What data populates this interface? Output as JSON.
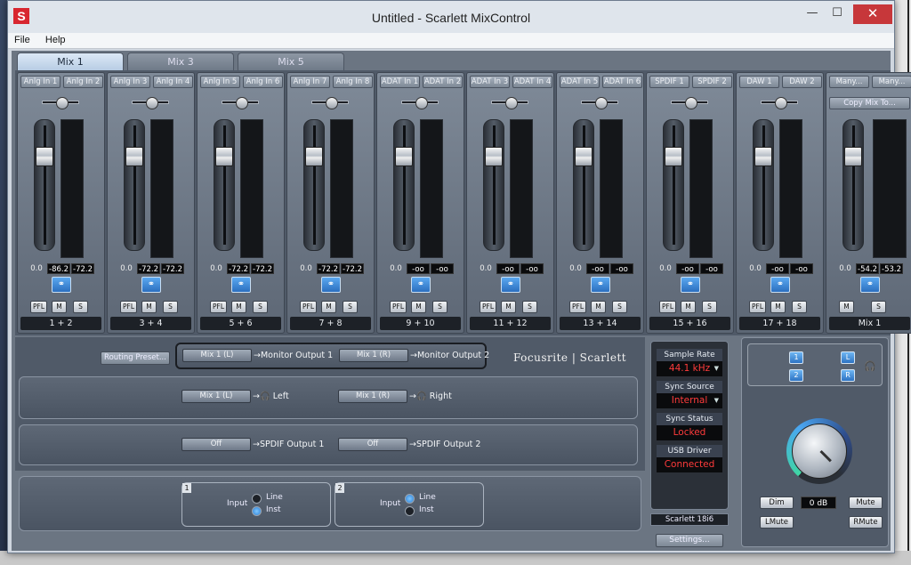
{
  "window": {
    "title": "Untitled - Scarlett MixControl",
    "app_icon_letter": "S",
    "min_glyph": "—",
    "max_glyph": "☐",
    "close_glyph": "✕"
  },
  "menu": [
    "File",
    "Help"
  ],
  "tabs": [
    {
      "label": "Mix 1",
      "active": true
    },
    {
      "label": "Mix 3",
      "active": false
    },
    {
      "label": "Mix 5",
      "active": false
    }
  ],
  "strips": [
    {
      "in_l": "Anlg In 1",
      "in_r": "Anlg In 2",
      "v0": "0.0",
      "v1": "-86.2",
      "v2": "-72.2",
      "pfl": "PFL",
      "m": "M",
      "s": "S",
      "name": "1 + 2",
      "level": 0.8
    },
    {
      "in_l": "Anlg In 3",
      "in_r": "Anlg In 4",
      "v0": "0.0",
      "v1": "-72.2",
      "v2": "-72.2",
      "pfl": "PFL",
      "m": "M",
      "s": "S",
      "name": "3 + 4",
      "level": 0.8
    },
    {
      "in_l": "Anlg In 5",
      "in_r": "Anlg In 6",
      "v0": "0.0",
      "v1": "-72.2",
      "v2": "-72.2",
      "pfl": "PFL",
      "m": "M",
      "s": "S",
      "name": "5 + 6",
      "level": 0.8
    },
    {
      "in_l": "Anlg In 7",
      "in_r": "Anlg In 8",
      "v0": "0.0",
      "v1": "-72.2",
      "v2": "-72.2",
      "pfl": "PFL",
      "m": "M",
      "s": "S",
      "name": "7 + 8",
      "level": 0.8
    },
    {
      "in_l": "ADAT In 1",
      "in_r": "ADAT In 2",
      "v0": "0.0",
      "v1": "-oo",
      "v2": "-oo",
      "pfl": "PFL",
      "m": "M",
      "s": "S",
      "name": "9 + 10",
      "level": 0.8
    },
    {
      "in_l": "ADAT In 3",
      "in_r": "ADAT In 4",
      "v0": "0.0",
      "v1": "-oo",
      "v2": "-oo",
      "pfl": "PFL",
      "m": "M",
      "s": "S",
      "name": "11 + 12",
      "level": 0.8
    },
    {
      "in_l": "ADAT In 5",
      "in_r": "ADAT In 6",
      "v0": "0.0",
      "v1": "-oo",
      "v2": "-oo",
      "pfl": "PFL",
      "m": "M",
      "s": "S",
      "name": "13 + 14",
      "level": 0.8
    },
    {
      "in_l": "SPDIF 1",
      "in_r": "SPDIF 2",
      "v0": "0.0",
      "v1": "-oo",
      "v2": "-oo",
      "pfl": "PFL",
      "m": "M",
      "s": "S",
      "name": "15 + 16",
      "level": 0.8
    },
    {
      "in_l": "DAW 1",
      "in_r": "DAW 2",
      "v0": "0.0",
      "v1": "-oo",
      "v2": "-oo",
      "pfl": "PFL",
      "m": "M",
      "s": "S",
      "name": "17 + 18",
      "level": 0.8
    }
  ],
  "mix_strip": {
    "in_l": "Many...",
    "in_r": "Many...",
    "copy": "Copy Mix To...",
    "v0": "0.0",
    "v1": "-54.2",
    "v2": "-53.2",
    "m": "M",
    "s": "S",
    "name": "Mix 1",
    "level": 0.8
  },
  "link_glyph": "⚭",
  "routing": {
    "preset": "Routing Preset...",
    "monitor": [
      {
        "src": "Mix 1 (L)",
        "dest": "→Monitor Output 1"
      },
      {
        "src": "Mix 1 (R)",
        "dest": "→Monitor Output 2"
      }
    ],
    "phones": [
      {
        "src": "Mix 1 (L)",
        "dest": "→🎧 Left"
      },
      {
        "src": "Mix 1 (R)",
        "dest": "→🎧 Right"
      }
    ],
    "spdif": [
      {
        "src": "Off",
        "dest": "→SPDIF Output 1"
      },
      {
        "src": "Off",
        "dest": "→SPDIF Output 2"
      }
    ],
    "brand": "Focusrite | Scarlett"
  },
  "inputs": [
    {
      "num": "1",
      "label": "Input",
      "opt1": "Line",
      "opt2": "Inst",
      "selected": "Inst"
    },
    {
      "num": "2",
      "label": "Input",
      "opt1": "Line",
      "opt2": "Inst",
      "selected": "Line"
    }
  ],
  "status": {
    "sample_rate_label": "Sample Rate",
    "sample_rate": "44.1 kHz",
    "sync_source_label": "Sync Source",
    "sync_source": "Internal",
    "sync_status_label": "Sync Status",
    "sync_status": "Locked",
    "usb_label": "USB  Driver",
    "usb": "Connected",
    "device": "Scarlett 18i6",
    "settings": "Settings...",
    "arrow": "▼"
  },
  "monitor": {
    "out_buttons": [
      "1",
      "2"
    ],
    "phone_buttons": [
      "L",
      "R"
    ],
    "phones_glyph": "🎧",
    "db": "0 dB",
    "dim": "Dim",
    "mute": "Mute",
    "lmute": "LMute",
    "rmute": "RMute"
  },
  "colors": {
    "accent_blue": "#2d73c3",
    "status_red": "#ff3b3b"
  }
}
